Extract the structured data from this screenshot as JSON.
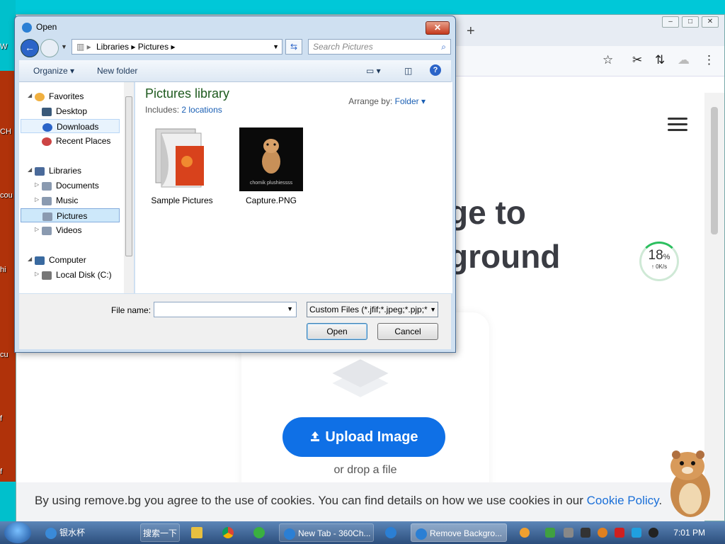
{
  "desktop": {
    "labels": [
      "W",
      "CH",
      "cou",
      "hi",
      "cu",
      "f",
      "f"
    ]
  },
  "browser": {
    "new_tab_symbol": "+",
    "window_buttons": [
      "–",
      "□",
      "✕"
    ],
    "toolbar_icons": [
      "star-icon",
      "scissors-icon",
      "sync-icon",
      "cloud-icon",
      "more-icon"
    ],
    "page": {
      "hero_line1": "ge to",
      "hero_line2": "ground",
      "speed_percent": "18",
      "speed_percent_unit": "%",
      "speed_rate": "↑ 0K/s",
      "upload_button": "Upload Image",
      "drop_text": "or drop a file",
      "cookie_text": "By using remove.bg you agree to the use of cookies. You can find details on how we use cookies in our ",
      "cookie_link": "Cookie Policy",
      "cookie_end": "."
    }
  },
  "dialog": {
    "title": "Open",
    "close": "✕",
    "breadcrumb": [
      "Libraries",
      "Pictures"
    ],
    "search_placeholder": "Search Pictures",
    "organize": "Organize ▾",
    "new_folder": "New folder",
    "help": "?",
    "nav": {
      "favorites": "Favorites",
      "desktop": "Desktop",
      "downloads": "Downloads",
      "recent": "Recent Places",
      "libraries": "Libraries",
      "documents": "Documents",
      "music": "Music",
      "pictures": "Pictures",
      "videos": "Videos",
      "computer": "Computer",
      "local_disk": "Local Disk (C:)"
    },
    "library_title": "Pictures library",
    "includes_label": "Includes: ",
    "includes_link": "2 locations",
    "arrange_label": "Arrange by: ",
    "arrange_value": "Folder ▾",
    "items": [
      {
        "label": "Sample Pictures"
      },
      {
        "label": "Capture.PNG",
        "thumb_caption": "chomik plushiessss"
      }
    ],
    "file_name_label": "File name:",
    "file_name_value": "",
    "filter": "Custom Files (*.jfif;*.jpeg;*.pjp;*",
    "open": "Open",
    "cancel": "Cancel"
  },
  "taskbar": {
    "ie_label": "银水杯",
    "search_button": "搜索一下",
    "task1": "New Tab - 360Ch...",
    "task2": "Remove Backgro...",
    "time": "7:01 PM"
  },
  "colors": {
    "accent": "#0f70e6",
    "library_title": "#1e5a1e",
    "link": "#1a5fb4"
  }
}
